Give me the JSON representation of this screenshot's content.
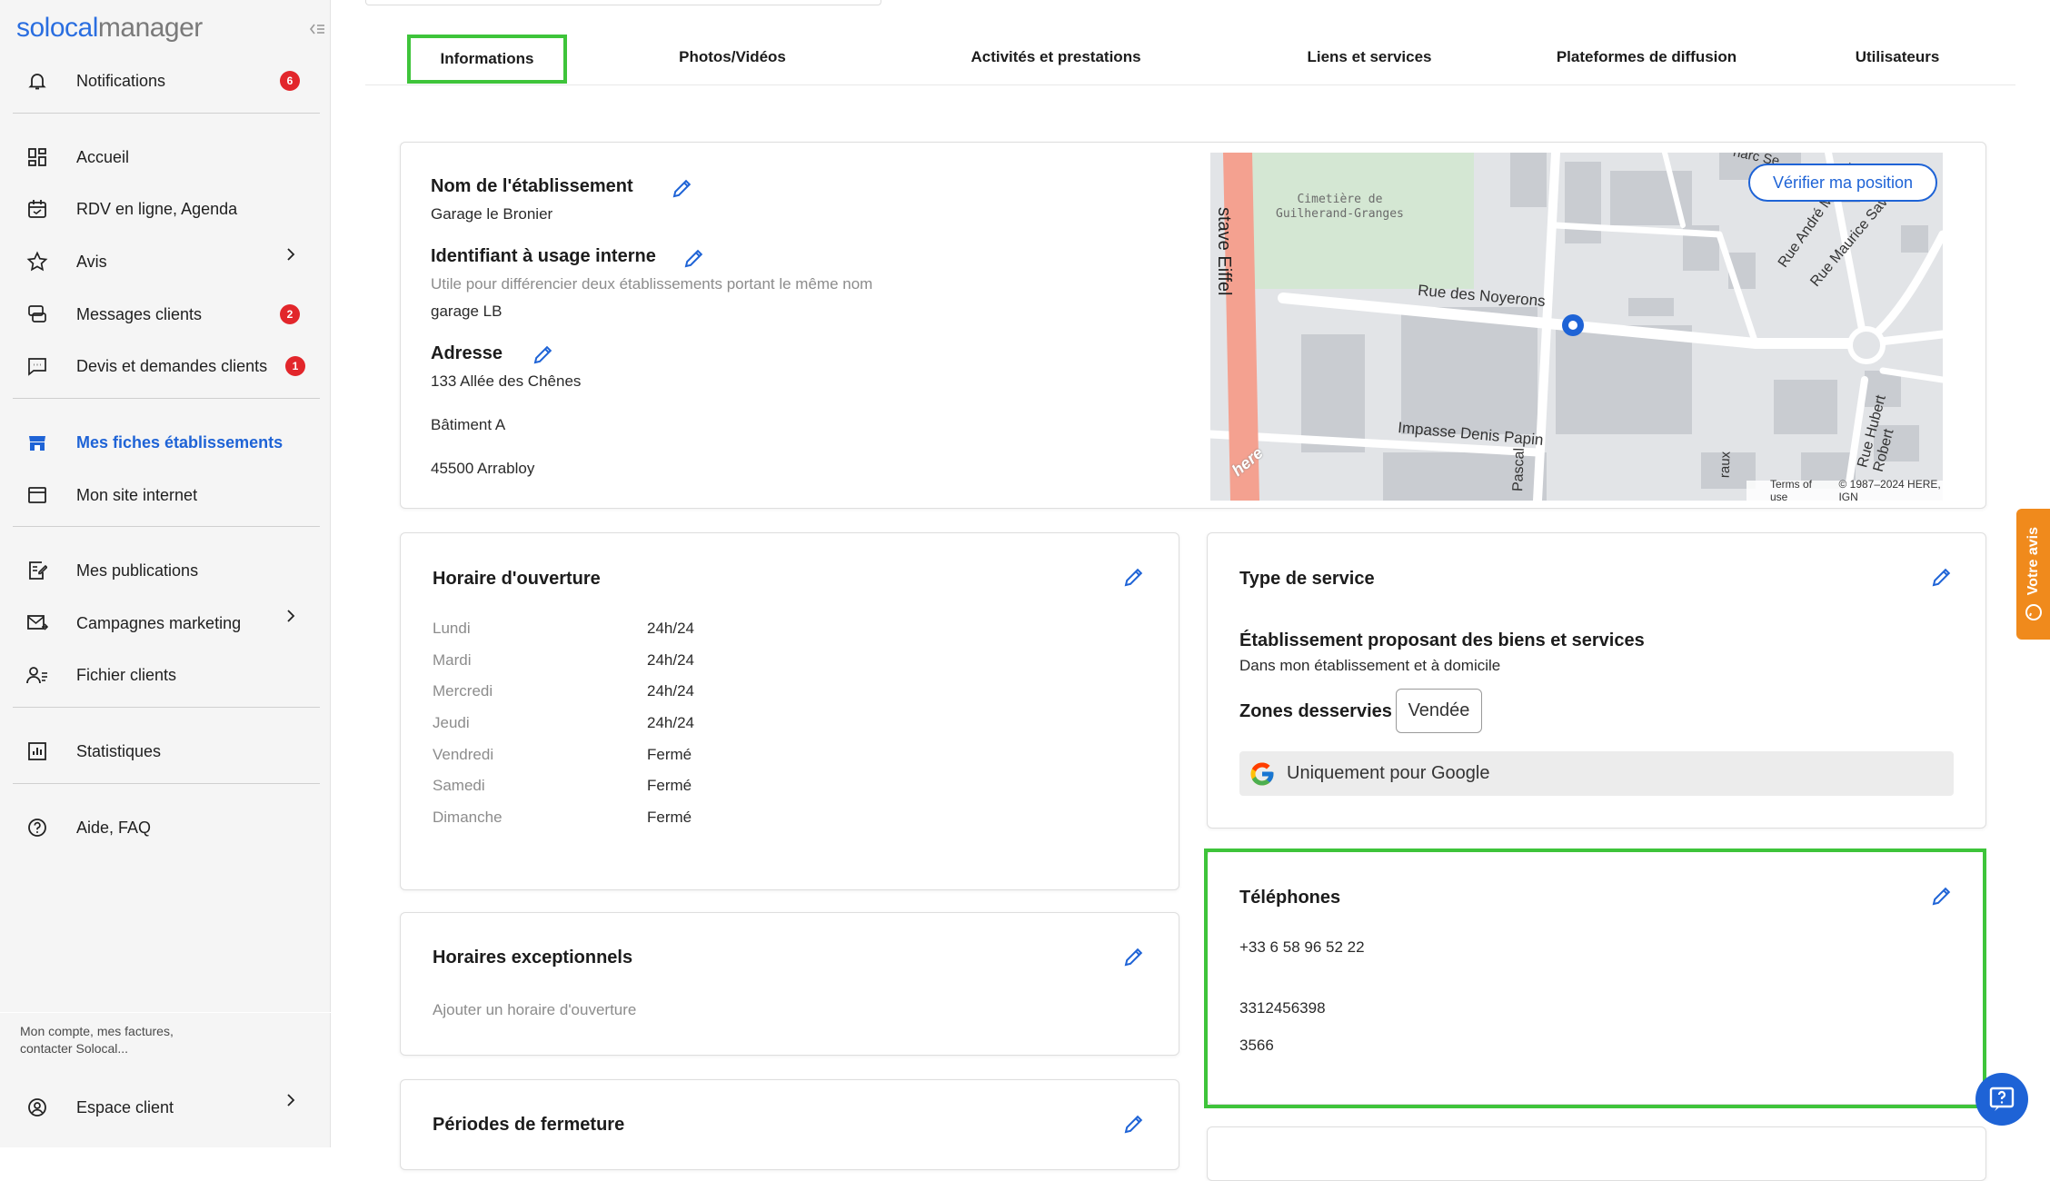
{
  "brand": {
    "part1": "solocal",
    "part2": "manager"
  },
  "sidebar": {
    "items": [
      {
        "label": "Notifications",
        "badge": "6"
      },
      {
        "label": "Accueil"
      },
      {
        "label": "RDV en ligne, Agenda"
      },
      {
        "label": "Avis"
      },
      {
        "label": "Messages clients",
        "badge": "2"
      },
      {
        "label": "Devis et demandes clients",
        "badge": "1"
      },
      {
        "label": "Mes fiches établissements"
      },
      {
        "label": "Mon site internet"
      },
      {
        "label": "Mes publications"
      },
      {
        "label": "Campagnes marketing"
      },
      {
        "label": "Fichier clients"
      },
      {
        "label": "Statistiques"
      },
      {
        "label": "Aide, FAQ"
      }
    ],
    "account_text": "Mon compte, mes factures, contacter Solocal...",
    "espace_client": "Espace client"
  },
  "tabs": [
    "Informations",
    "Photos/Vidéos",
    "Activités et prestations",
    "Liens et services",
    "Plateformes de diffusion",
    "Utilisateurs"
  ],
  "etablissement": {
    "name_label": "Nom de l'établissement",
    "name_value": "Garage le Bronier",
    "internal_id_label": "Identifiant à usage interne",
    "internal_id_help": "Utile pour différencier deux établissements portant le même nom",
    "internal_id_value": "garage LB",
    "address_label": "Adresse",
    "address_line1": "133 Allée des Chênes",
    "address_line2": "Bâtiment A",
    "address_line3": "45500 Arrabloy"
  },
  "map": {
    "verify_button": "Vérifier ma position",
    "cemetery": "Cimetière de",
    "cemetery2": "Guilherand-Granges",
    "street1": "Rue des Noyerons",
    "street2": "Impasse Denis Papin",
    "street3": "stave Eiffel",
    "street4": "Rue André Malraux",
    "street5": "Rue Maurice Savin",
    "street6": "Rue Hubert Robert",
    "street7": "Pascal",
    "street8": "raux",
    "street9": "narc Se",
    "here_logo": "here",
    "terms": "Terms of use",
    "copyright": "© 1987–2024 HERE, IGN"
  },
  "hours": {
    "title": "Horaire d'ouverture",
    "days": [
      {
        "day": "Lundi",
        "value": "24h/24"
      },
      {
        "day": "Mardi",
        "value": "24h/24"
      },
      {
        "day": "Mercredi",
        "value": "24h/24"
      },
      {
        "day": "Jeudi",
        "value": "24h/24"
      },
      {
        "day": "Vendredi",
        "value": "Fermé"
      },
      {
        "day": "Samedi",
        "value": "Fermé"
      },
      {
        "day": "Dimanche",
        "value": "Fermé"
      }
    ]
  },
  "exceptional": {
    "title": "Horaires exceptionnels",
    "placeholder": "Ajouter un horaire d'ouverture"
  },
  "closing": {
    "title": "Périodes de fermeture"
  },
  "service": {
    "title": "Type de service",
    "type_title": "Établissement proposant des biens et services",
    "type_sub": "Dans mon établissement et à domicile",
    "zones_label": "Zones desservies",
    "zone_chip": "Vendée",
    "google_label": "Uniquement pour Google"
  },
  "phones": {
    "title": "Téléphones",
    "numbers": [
      "+33 6 58 96 52 22",
      "3312456398",
      "3566"
    ]
  },
  "votre_avis": "Votre avis",
  "colors": {
    "accent": "#1e63d6",
    "highlight": "#3ec43a",
    "badge": "#e2262b",
    "feedback": "#f08a1c"
  }
}
